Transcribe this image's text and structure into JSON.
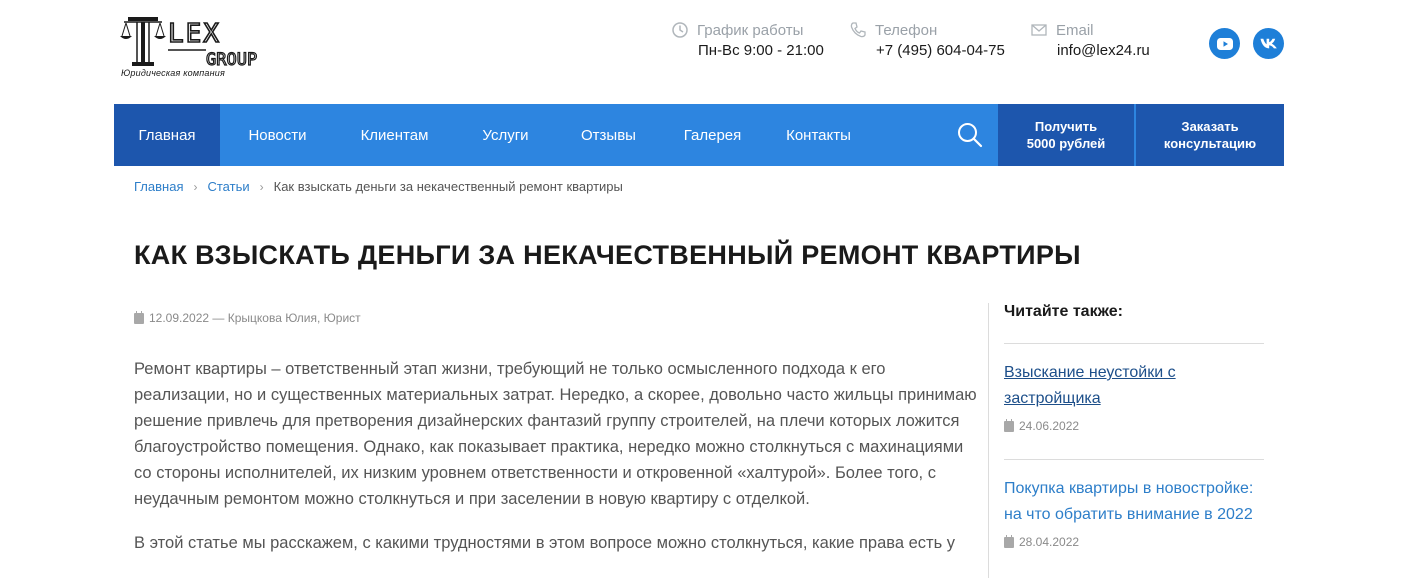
{
  "header": {
    "logo_text": "LEX GROUP",
    "logo_subtitle": "Юридическая компания",
    "schedule": {
      "label": "График работы",
      "value": "Пн-Вс 9:00 - 21:00",
      "icon": "clock-icon"
    },
    "phone": {
      "label": "Телефон",
      "value": "+7 (495) 604-04-75",
      "icon": "phone-icon"
    },
    "email": {
      "label": "Email",
      "value": "info@lex24.ru",
      "icon": "envelope-icon"
    },
    "social": [
      "youtube-icon",
      "vk-icon"
    ]
  },
  "nav": {
    "items": [
      {
        "label": "Главная",
        "active": true
      },
      {
        "label": "Новости"
      },
      {
        "label": "Клиентам"
      },
      {
        "label": "Услуги"
      },
      {
        "label": "Отзывы"
      },
      {
        "label": "Галерея"
      },
      {
        "label": "Контакты"
      }
    ],
    "cta1_line1": "Получить",
    "cta1_line2": "5000 рублей",
    "cta2_line1": "Заказать",
    "cta2_line2": "консультацию"
  },
  "breadcrumb": {
    "home": "Главная",
    "section": "Статьи",
    "current": "Как взыскать деньги за некачественный ремонт квартиры"
  },
  "article": {
    "title": "КАК ВЗЫСКАТЬ ДЕНЬГИ ЗА НЕКАЧЕСТВЕННЫЙ РЕМОНТ КВАРТИРЫ",
    "meta": "12.09.2022 — Крыцкова Юлия, Юрист",
    "p1": "Ремонт квартиры – ответственный этап жизни, требующий не только осмысленного подхода к его реализации, но и существенных материальных затрат. Нередко, а скорее, довольно часто жильцы принимаю решение привлечь для претворения дизайнерских фантазий группу строителей, на плечи которых ложится благоустройство помещения. Однако, как показывает практика, нередко можно столкнуться с махинациями со стороны исполнителей, их низким уровнем ответственности и откровенной «халтурой». Более того, с неудачным ремонтом можно столкнуться и при заселении в новую квартиру с отделкой.",
    "p2": "В этой статье мы расскажем, с какими трудностями в этом вопросе можно столкнуться, какие права есть у"
  },
  "sidebar": {
    "title": "Читайте также:",
    "items": [
      {
        "title": "Взыскание неустойки с застройщика",
        "date": "24.06.2022"
      },
      {
        "title": "Покупка квартиры в новостройке: на что обратить внимание в 2022",
        "date": "28.04.2022"
      }
    ]
  },
  "colors": {
    "nav_bg": "#2d85e0",
    "nav_active": "#1d56ad",
    "link": "#2d7ec9",
    "social": "#1e7fd8"
  }
}
